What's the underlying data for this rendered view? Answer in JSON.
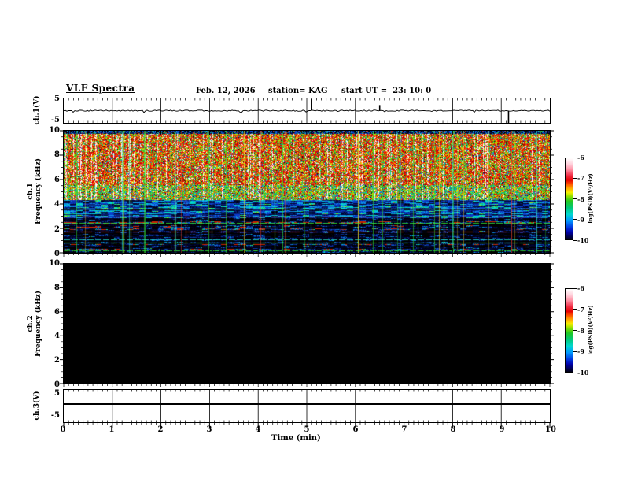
{
  "title": {
    "main": "VLF Spectra",
    "date": "Feb. 12, 2026",
    "station": "station= KAG",
    "start_ut": "start UT =  23: 10: 0"
  },
  "axes": {
    "time": {
      "label": "Time (min)",
      "min": 0,
      "max": 10,
      "major_step": 1,
      "minor_step": 0.1,
      "tick_labels": [
        "0",
        "1",
        "2",
        "3",
        "4",
        "5",
        "6",
        "7",
        "8",
        "9",
        "10"
      ]
    },
    "freq": {
      "unit": "kHz",
      "min": 0,
      "max": 10,
      "major_step": 2,
      "minor_step": 0.5,
      "tick_labels": [
        "10",
        "8",
        "6",
        "4",
        "2",
        "0"
      ]
    },
    "volt": {
      "min": -5,
      "max": 5,
      "tick_labels": [
        "5",
        "-5"
      ]
    },
    "ch1v_label": "ch.1(V)",
    "ch3v_label": "ch.3(V)",
    "spec1_label": [
      "ch.1",
      "Frequency (kHz)"
    ],
    "spec2_label": [
      "ch.2",
      "Frequency (kHz)"
    ]
  },
  "colorbar": {
    "label": "log(PSD)(V²/Hz)",
    "min": -10,
    "max": -6,
    "tick_labels": [
      "-6",
      "-7",
      "-8",
      "-9",
      "-10"
    ],
    "gradient": [
      {
        "pos": 0,
        "color": "#ffffff"
      },
      {
        "pos": 7,
        "color": "#ffd2dc"
      },
      {
        "pos": 14,
        "color": "#ff8fa2"
      },
      {
        "pos": 21,
        "color": "#f23048"
      },
      {
        "pos": 27,
        "color": "#e60000"
      },
      {
        "pos": 32,
        "color": "#ff5500"
      },
      {
        "pos": 37,
        "color": "#ffaa00"
      },
      {
        "pos": 42,
        "color": "#f8ee00"
      },
      {
        "pos": 47,
        "color": "#8ee000"
      },
      {
        "pos": 53,
        "color": "#22c822"
      },
      {
        "pos": 61,
        "color": "#00c878"
      },
      {
        "pos": 69,
        "color": "#00d8d0"
      },
      {
        "pos": 77,
        "color": "#0096ff"
      },
      {
        "pos": 85,
        "color": "#0038e0"
      },
      {
        "pos": 91,
        "color": "#0000aa"
      },
      {
        "pos": 96,
        "color": "#000055"
      },
      {
        "pos": 100,
        "color": "#000014"
      }
    ]
  },
  "chart_data": [
    {
      "type": "line",
      "panel": "ch.1 waveform",
      "ylabel": "ch.1(V)",
      "ylim": [
        -5,
        5
      ],
      "xlim": [
        0,
        10
      ],
      "baseline_V": 0,
      "noise_amplitude_V": 0.3,
      "spikes": [
        {
          "t_min": 5.1,
          "amplitude_V": 4.8
        },
        {
          "t_min": 6.5,
          "amplitude_V": 2.3
        },
        {
          "t_min": 9.15,
          "amplitude_V": -5.0
        }
      ]
    },
    {
      "type": "heatmap",
      "panel": "ch.1 spectrogram",
      "ylabel": "Frequency (kHz)",
      "ylim": [
        0,
        10
      ],
      "xlim": [
        0,
        10
      ],
      "zlabel": "log(PSD)(V²/Hz)",
      "zlim": [
        -10,
        -6
      ],
      "bands": [
        {
          "f_khz": [
            4.4,
            10
          ],
          "character": "intense broadband impulsive sferics, PSD near -6.5 to -7.5",
          "dominant_colors": [
            "red",
            "orange",
            "white",
            "green"
          ]
        },
        {
          "f_khz": [
            2.9,
            4.4
          ],
          "character": "moderate dashed activity, PSD near -8.5 to -9",
          "dominant_colors": [
            "blue",
            "cyan"
          ]
        },
        {
          "f_khz": [
            0,
            2.9
          ],
          "character": "weak banded background, PSD near -9.5 to -10",
          "dominant_colors": [
            "black",
            "dark blue"
          ]
        }
      ],
      "horizontal_lines_khz": [
        {
          "f": 3.6,
          "color": "green"
        },
        {
          "f": 2.4,
          "color": "green"
        },
        {
          "f": 1.05,
          "color": "cyan"
        },
        {
          "f": 0.8,
          "color": "green"
        },
        {
          "f": 0.15,
          "color": "green"
        },
        {
          "f": 2.95,
          "color": "red"
        },
        {
          "f": 1.7,
          "color": "red"
        }
      ],
      "vertical_event_lines": {
        "count": 46,
        "colors": [
          "green",
          "yellow",
          "red",
          "cyan"
        ]
      }
    },
    {
      "type": "heatmap",
      "panel": "ch.2 spectrogram",
      "ylabel": "Frequency (kHz)",
      "ylim": [
        0,
        10
      ],
      "xlim": [
        0,
        10
      ],
      "zlabel": "log(PSD)(V²/Hz)",
      "zlim": [
        -10,
        -6
      ],
      "character": "no signal - uniform minimum level (black)"
    },
    {
      "type": "line",
      "panel": "ch.3 waveform",
      "ylabel": "ch.3(V)",
      "ylim": [
        -5,
        5
      ],
      "xlim": [
        0,
        10
      ],
      "baseline_V": 0,
      "character": "flat line at 0 V"
    }
  ]
}
